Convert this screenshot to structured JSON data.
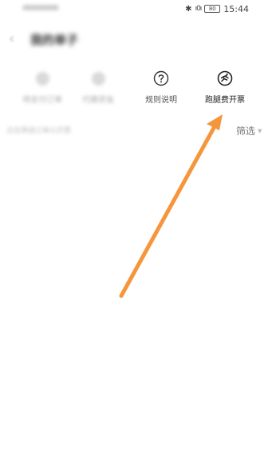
{
  "status_bar": {
    "carrier": "中国移动",
    "bluetooth": "✱",
    "vibrate": "ı0ı",
    "battery": "80",
    "time": "15:44"
  },
  "header": {
    "back": "‹",
    "title": "我的单子"
  },
  "actions": [
    {
      "label": "待支付订单",
      "icon": "blurred-icon"
    },
    {
      "label": "代缴资金",
      "icon": "blurred-icon"
    },
    {
      "label": "规则说明",
      "icon": "question-circle-icon"
    },
    {
      "label": "跑腿费开票",
      "icon": "runner-circle-icon"
    }
  ],
  "filter": {
    "hint": "点击筛选订单以开票",
    "label": "筛选",
    "caret": "▼"
  },
  "annotation": {
    "color": "#f5963c"
  }
}
